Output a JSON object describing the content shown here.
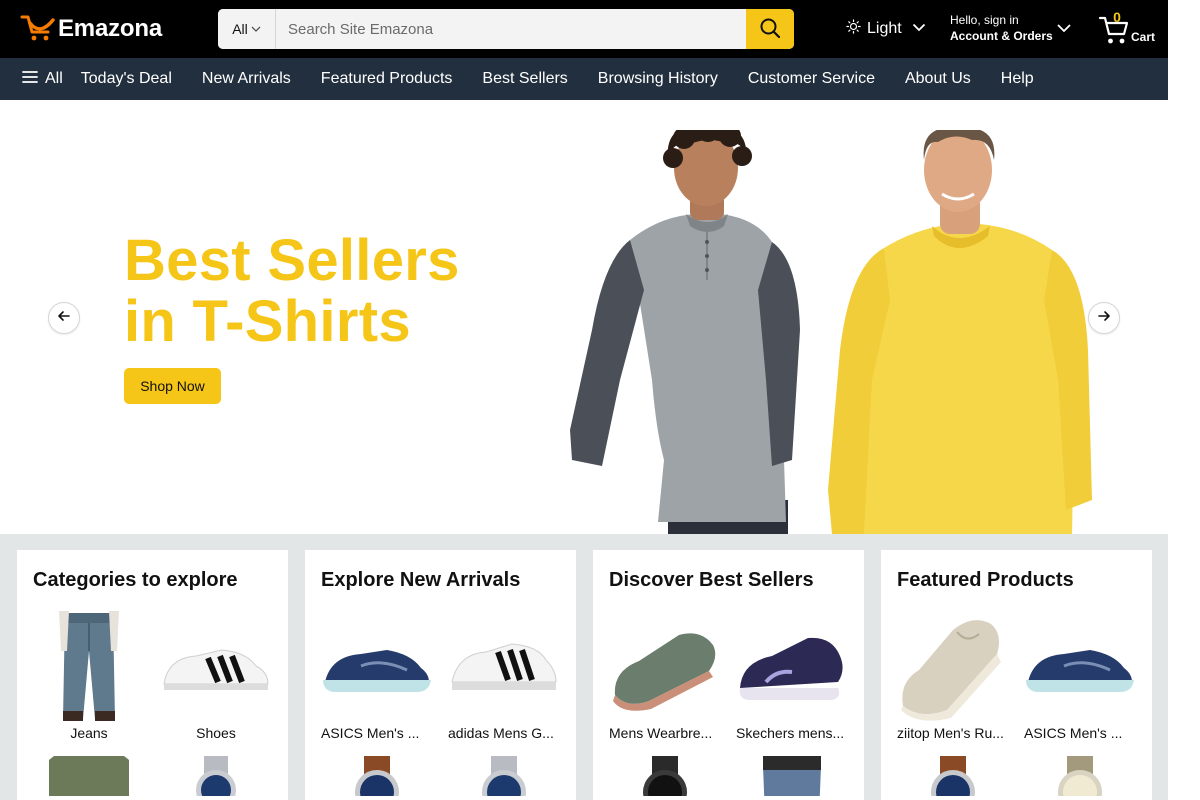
{
  "header": {
    "logo_text": "Emazona",
    "search": {
      "category": "All",
      "placeholder": "Search Site Emazona"
    },
    "theme": {
      "label": "Light"
    },
    "account": {
      "greeting": "Hello, sign in",
      "label": "Account & Orders"
    },
    "cart": {
      "count": "0",
      "label": "Cart"
    }
  },
  "nav": {
    "all_label": "All",
    "items": [
      "Today's Deal",
      "New Arrivals",
      "Featured Products",
      "Best Sellers",
      "Browsing History",
      "Customer Service",
      "About Us",
      "Help"
    ]
  },
  "hero": {
    "title_line1": "Best Sellers",
    "title_line2": "in T-Shirts",
    "button_label": "Shop Now"
  },
  "cards": [
    {
      "title": "Categories to explore",
      "items": [
        {
          "label": "Jeans",
          "icon": "jeans-image"
        },
        {
          "label": "Shoes",
          "icon": "white-sneaker-image"
        },
        {
          "label": "",
          "icon": "tshirt-image"
        },
        {
          "label": "",
          "icon": "watch-image"
        }
      ]
    },
    {
      "title": "Explore New Arrivals",
      "items": [
        {
          "label": "ASICS Men's ...",
          "icon": "blue-running-shoe-image"
        },
        {
          "label": "adidas Mens G...",
          "icon": "white-sneaker-image"
        },
        {
          "label": "",
          "icon": "watch-image"
        },
        {
          "label": "",
          "icon": "watch-image"
        }
      ]
    },
    {
      "title": "Discover Best Sellers",
      "items": [
        {
          "label": "Mens Wearbre...",
          "icon": "green-shoe-image"
        },
        {
          "label": "Skechers mens...",
          "icon": "navy-shoe-image"
        },
        {
          "label": "",
          "icon": "watch-image"
        },
        {
          "label": "",
          "icon": "jeans-image"
        }
      ]
    },
    {
      "title": "Featured Products",
      "items": [
        {
          "label": "ziitop Men's Ru...",
          "icon": "beige-shoe-image"
        },
        {
          "label": "ASICS Men's ...",
          "icon": "blue-running-shoe-image"
        },
        {
          "label": "",
          "icon": "watch-image"
        },
        {
          "label": "",
          "icon": "watch-image"
        }
      ]
    }
  ],
  "colors": {
    "accent": "#f5c518",
    "header_bg": "#000000",
    "nav_bg": "#222f3e",
    "cards_bg": "#e3e6e6"
  }
}
